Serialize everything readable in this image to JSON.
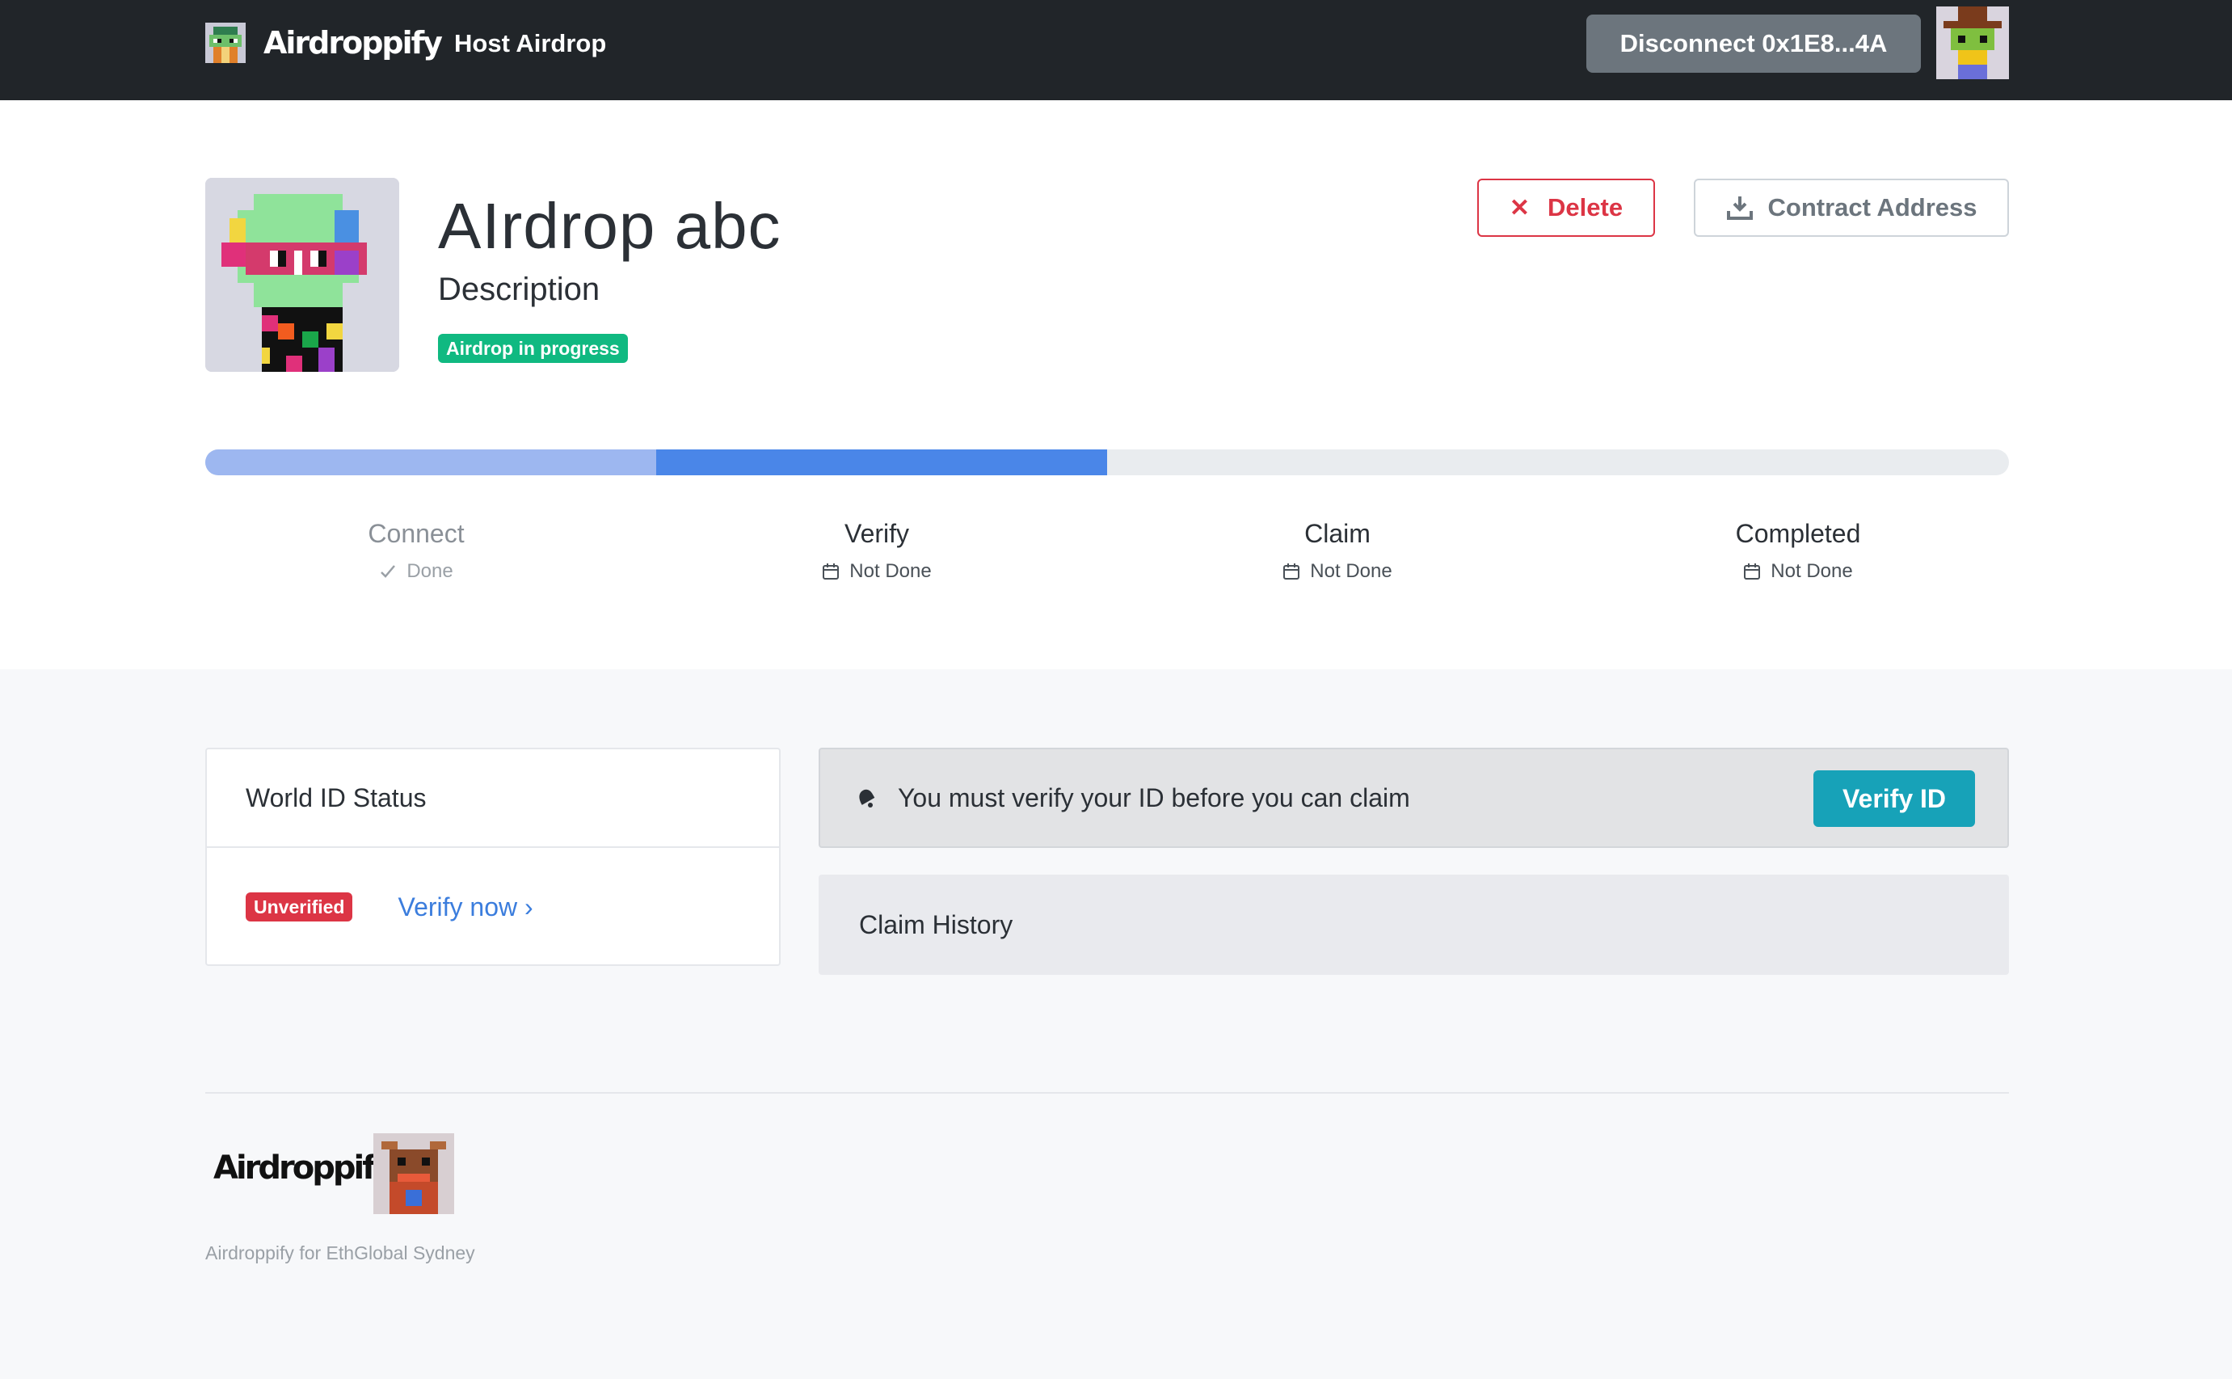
{
  "navbar": {
    "brand": "Airdroppify",
    "host_link": "Host Airdrop",
    "disconnect_label": "Disconnect 0x1E8...4A"
  },
  "airdrop": {
    "title": "AIrdrop abc",
    "description": "Description",
    "status": "Airdrop in progress",
    "delete_label": "Delete",
    "contract_label": "Contract Address"
  },
  "progress": {
    "done_fraction": 0.25,
    "current_fraction": 0.25,
    "steps": [
      {
        "name": "Connect",
        "status": "Done",
        "done": true
      },
      {
        "name": "Verify",
        "status": "Not Done",
        "done": false
      },
      {
        "name": "Claim",
        "status": "Not Done",
        "done": false
      },
      {
        "name": "Completed",
        "status": "Not Done",
        "done": false
      }
    ]
  },
  "world_id": {
    "title": "World ID Status",
    "badge": "Unverified",
    "link": "Verify now ›"
  },
  "alert": {
    "message": "You must verify your ID before you can claim",
    "button": "Verify ID"
  },
  "claim_history": {
    "title": "Claim History"
  },
  "footer": {
    "brand": "Airdroppify",
    "note": "Airdroppify for EthGlobal Sydney"
  },
  "colors": {
    "navbar_bg": "#212529",
    "status_green": "#10b981",
    "danger": "#dc3545",
    "info": "#17a2b8",
    "progress_done": "#9db7f0",
    "progress_current": "#4a86e8"
  },
  "icons": {
    "delete": "close-icon",
    "contract": "download-icon",
    "step_done": "check-icon",
    "step_pending": "calendar-icon",
    "alert": "bell-icon"
  }
}
